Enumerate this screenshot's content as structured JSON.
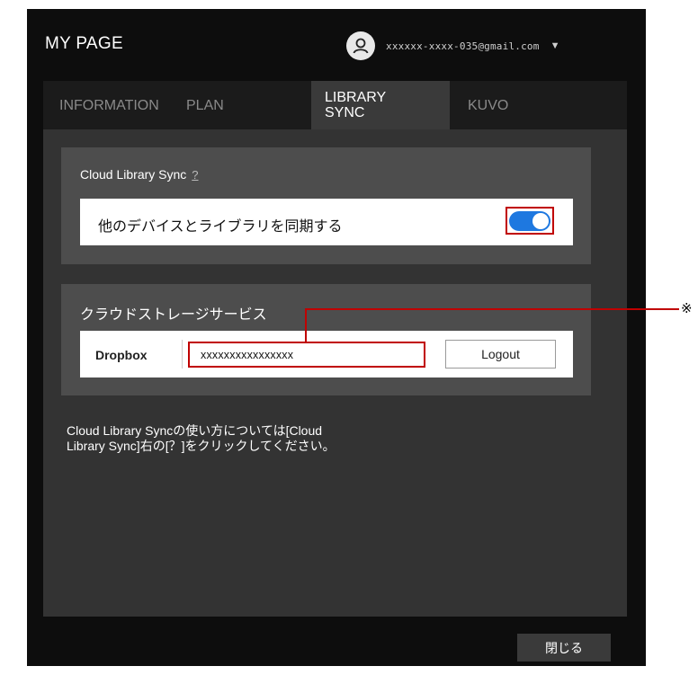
{
  "window": {
    "title": "MY PAGE"
  },
  "account": {
    "email": "xxxxxx-xxxx-035@gmail.com",
    "avatar_icon": "user-icon",
    "dropdown_glyph": "▼"
  },
  "tabs": [
    {
      "label": "INFORMATION",
      "active": false
    },
    {
      "label": "PLAN",
      "active": false
    },
    {
      "label": "LIBRARY\nSYNC",
      "active": true
    },
    {
      "label": "KUVO",
      "active": false
    }
  ],
  "cloud_sync": {
    "title": "Cloud Library Sync",
    "help_link": "?",
    "toggle_label": "他のデバイスとライブラリを同期する",
    "toggle_on": true
  },
  "storage": {
    "title": "クラウドストレージサービス",
    "provider": "Dropbox",
    "account_value": "xxxxxxxxxxxxxxxx",
    "logout_label": "Logout"
  },
  "info_text": "Cloud Library Syncの使い方については[Cloud\nLibrary Sync]右の[？]をクリックしてください。",
  "close_label": "閉じる",
  "annotation": {
    "mark": "※"
  },
  "colors": {
    "accent": "#1e78e0",
    "highlight": "#c00000",
    "background": "#0d0d0d",
    "panel": "#4d4d4d"
  }
}
